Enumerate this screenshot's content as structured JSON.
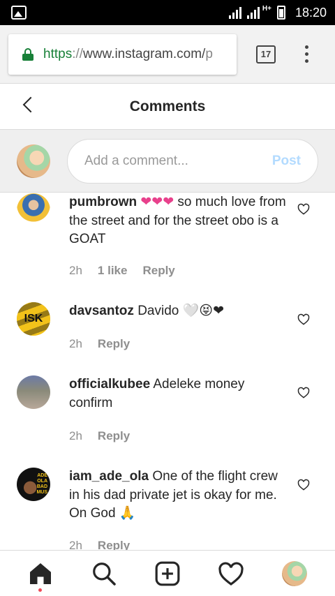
{
  "status_bar": {
    "time": "18:20",
    "network": "H+"
  },
  "browser": {
    "url_scheme": "https",
    "url_sep": "://",
    "url_host": "www.instagram.com/",
    "url_tail": "p",
    "tab_count": "17"
  },
  "header": {
    "title": "Comments"
  },
  "composer": {
    "placeholder": "Add a comment...",
    "post_label": "Post"
  },
  "comments": [
    {
      "user": "pumbrown",
      "emoji": "❤❤❤",
      "text": " so much love from the street and for the street obo is a GOAT",
      "time": "2h",
      "likes": "1 like",
      "reply": "Reply"
    },
    {
      "user": "davsantoz",
      "text": " Davido 🤍😝❤",
      "time": "2h",
      "reply": "Reply"
    },
    {
      "user": "officialkubee",
      "text": " Adeleke money confirm",
      "time": "2h",
      "reply": "Reply"
    },
    {
      "user": "iam_ade_ola",
      "text": " One of the flight crew in his dad private jet is okay for me. On God 🙏",
      "time": "2h",
      "reply": "Reply"
    }
  ],
  "avatar_text": {
    "davsantoz": "ISK",
    "iam_ade_ola": [
      "ADE",
      "OLA",
      "BAD",
      "MUS"
    ]
  },
  "colors": {
    "accent_pink": "#e8418c",
    "post_disabled": "#b3dbff",
    "lock_green": "#188038"
  },
  "nav": {
    "items": [
      "home-icon",
      "search-icon",
      "new-post-icon",
      "activity-heart-icon",
      "profile-avatar"
    ]
  }
}
